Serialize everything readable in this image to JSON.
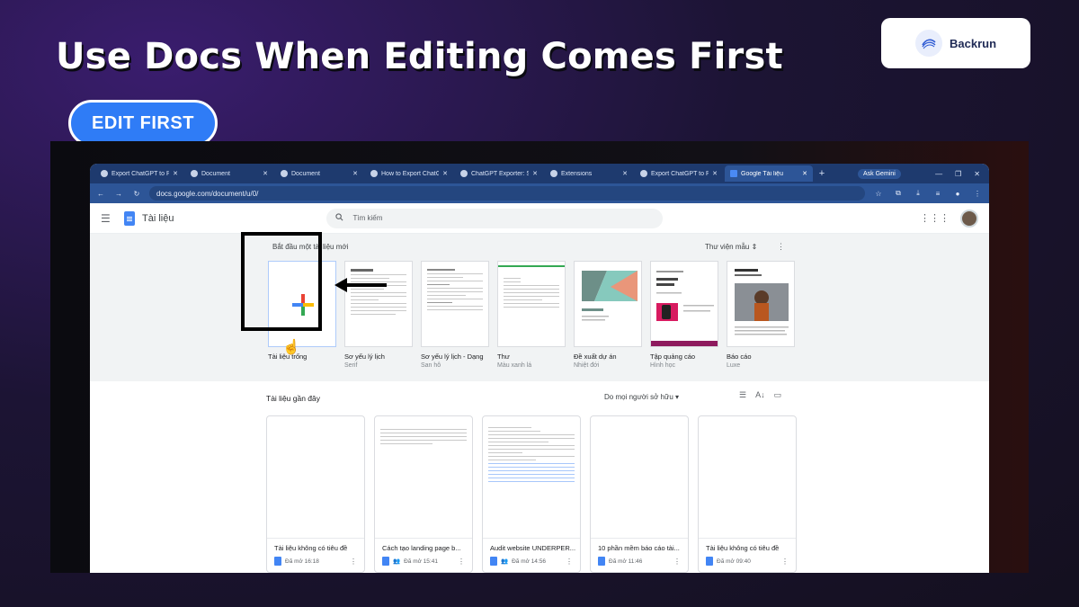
{
  "slide": {
    "title": "Use Docs When Editing Comes First",
    "pill": "EDIT FIRST",
    "brand": "Backrun"
  },
  "browser": {
    "tabs": [
      {
        "label": "Export ChatGPT to PDF"
      },
      {
        "label": "Document"
      },
      {
        "label": "Document"
      },
      {
        "label": "How to Export ChatGPT"
      },
      {
        "label": "ChatGPT Exporter: Sav"
      },
      {
        "label": "Extensions"
      },
      {
        "label": "Export ChatGPT to PDF"
      },
      {
        "label": "Google Tài liệu"
      }
    ],
    "gemini": "Ask Gemini",
    "url": "docs.google.com/document/u/0/"
  },
  "docs": {
    "app_name": "Tài liệu",
    "search_placeholder": "Tìm kiếm",
    "start_heading": "Bắt đầu một tài liệu mới",
    "gallery_label": "Thư viện mẫu",
    "templates": [
      {
        "name": "Tài liệu trống",
        "sub": ""
      },
      {
        "name": "Sơ yếu lý lịch",
        "sub": "Serif"
      },
      {
        "name": "Sơ yếu lý lịch - Dạng",
        "sub": "San hô"
      },
      {
        "name": "Thư",
        "sub": "Màu xanh lá"
      },
      {
        "name": "Đề xuất dự án",
        "sub": "Nhiệt đới"
      },
      {
        "name": "Tập quảng cáo",
        "sub": "Hình học"
      },
      {
        "name": "Báo cáo",
        "sub": "Luxe"
      }
    ],
    "recent_heading": "Tài liệu gần đây",
    "owner_filter": "Do mọi người sở hữu",
    "recent": [
      {
        "title": "Tài liệu không có tiêu đề",
        "meta": "Đã mở 16:18"
      },
      {
        "title": "Cách tạo landing page b...",
        "meta": "Đã mở 15:41"
      },
      {
        "title": "Audit website UNDERPER...",
        "meta": "Đã mở 14:56"
      },
      {
        "title": "10 phần mềm báo cáo tài...",
        "meta": "Đã mở 11:46"
      },
      {
        "title": "Tài liệu không có tiêu đề",
        "meta": "Đã mở 09:40"
      }
    ]
  }
}
